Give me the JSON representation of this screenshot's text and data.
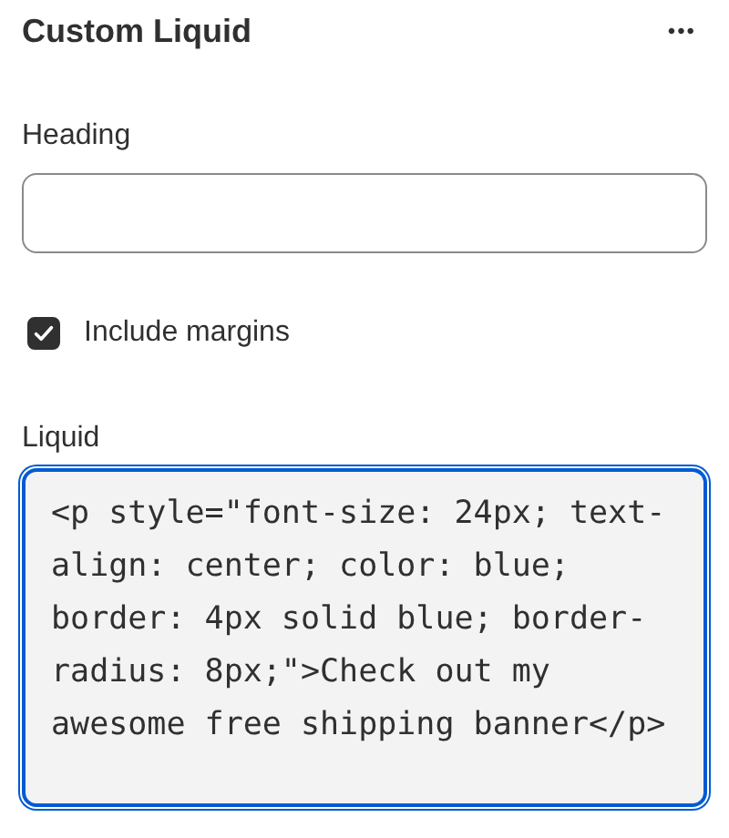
{
  "panel": {
    "title": "Custom Liquid",
    "menu_icon_text": "•••"
  },
  "fields": [
    {
      "kind": "text",
      "label": "Heading"
    },
    {
      "kind": "checkbox",
      "label": "Include margins",
      "checked": true
    },
    {
      "kind": "code",
      "label": "Liquid",
      "value": "<p style=\"font-size: 24px; text-align: center; color: blue;  border: 4px solid blue; border-radius: 8px;\">Check out my awesome free shipping banner</p>",
      "focused": true
    }
  ]
}
